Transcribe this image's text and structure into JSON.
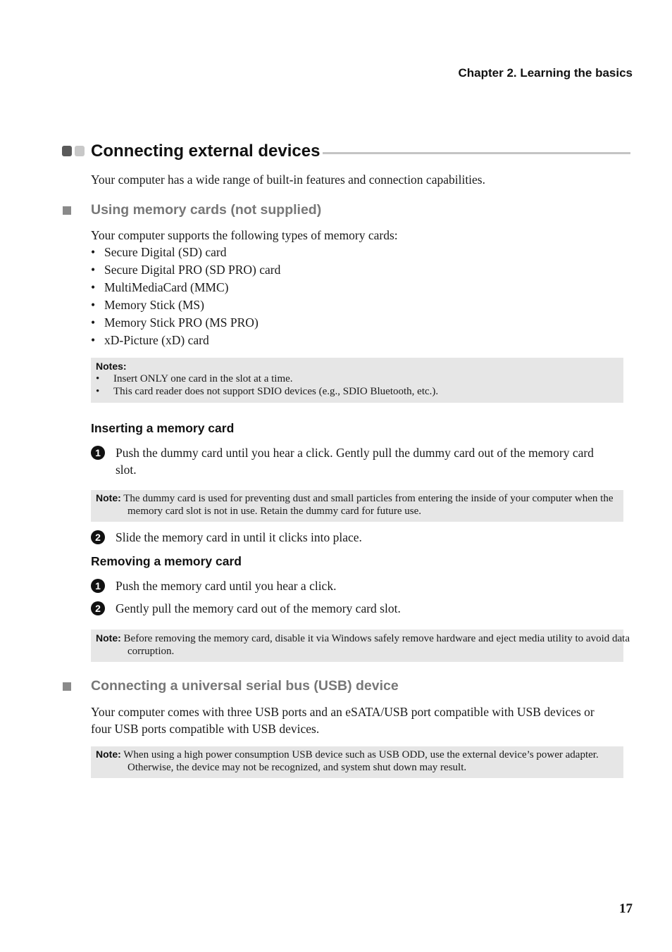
{
  "header": {
    "chapter": "Chapter 2. Learning the basics"
  },
  "section": {
    "title": "Connecting external devices",
    "intro": "Your computer has a wide range of built-in features and connection capabilities."
  },
  "memory_cards": {
    "heading": "Using memory cards (not supplied)",
    "intro": "Your computer supports the following types of memory cards:",
    "bullet_glyph": "•",
    "types": [
      "Secure Digital (SD) card",
      "Secure Digital PRO (SD PRO) card",
      "MultiMediaCard (MMC)",
      "Memory Stick (MS)",
      "Memory Stick PRO (MS PRO)",
      "xD-Picture (xD) card"
    ],
    "notes": {
      "label": "Notes:",
      "items": [
        "Insert ONLY one card in the slot at a time.",
        "This card reader does not support SDIO devices (e.g., SDIO Bluetooth, etc.)."
      ]
    },
    "inserting": {
      "heading": "Inserting a memory card",
      "steps": [
        {
          "num": "1",
          "text": "Push the dummy card until you hear a click. Gently pull the dummy card out of the memory card slot."
        },
        {
          "num": "2",
          "text": "Slide the memory card in until it clicks into place."
        }
      ],
      "note": {
        "label": "Note:",
        "text": "The dummy card is used for preventing dust and small particles from entering the inside of your computer when the memory card slot is not in use. Retain the dummy card for future use."
      }
    },
    "removing": {
      "heading": "Removing a memory card",
      "steps": [
        {
          "num": "1",
          "text": "Push the memory card until you hear a click."
        },
        {
          "num": "2",
          "text": "Gently pull the memory card out of the memory card slot."
        }
      ],
      "note": {
        "label": "Note:",
        "text": "Before removing the memory card, disable it via Windows safely remove hardware and eject media utility to avoid data corruption."
      }
    }
  },
  "usb": {
    "heading": "Connecting a universal serial bus (USB) device",
    "body": "Your computer comes with three USB ports and an eSATA/USB port compatible with USB devices or four USB ports compatible with USB devices.",
    "note": {
      "label": "Note:",
      "text": "When using a high power consumption USB device such as USB ODD, use the external device’s power adapter. Otherwise, the device may not be recognized, and system shut down may result."
    }
  },
  "footer": {
    "page_number": "17"
  }
}
